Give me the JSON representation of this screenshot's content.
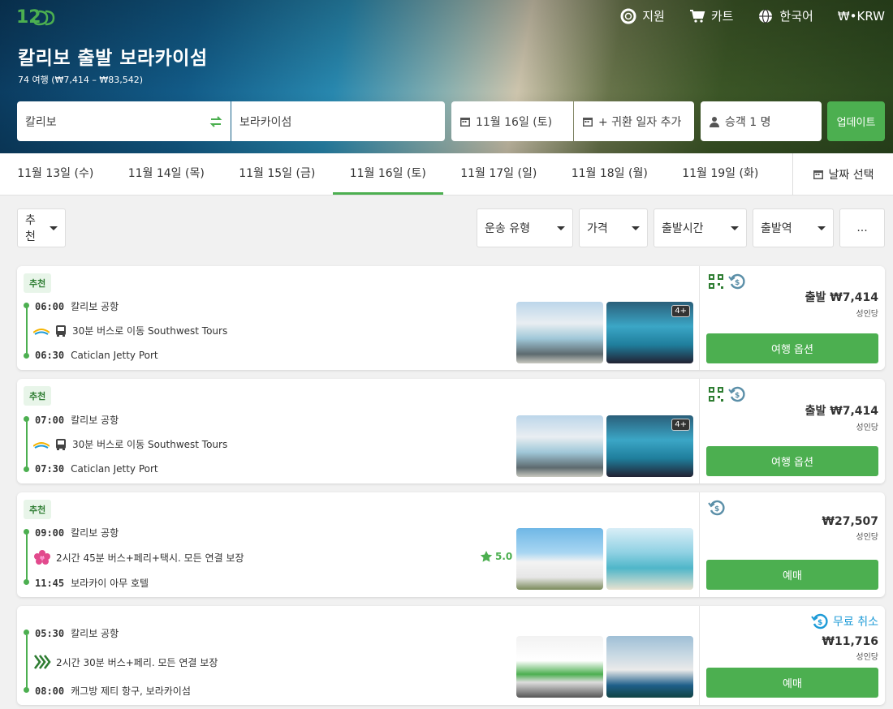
{
  "brand": {
    "logo_text": "12Go"
  },
  "topnav": {
    "support": "지원",
    "cart": "카트",
    "language": "한국어",
    "currency": "₩•KRW"
  },
  "header": {
    "title": "칼리보 출발 보라카이섬",
    "subtitle": "74 여행 (₩7,414 – ₩83,542)"
  },
  "search": {
    "from": "칼리보",
    "to": "보라카이섬",
    "date": "11월 16일 (토)",
    "return": "+ 귀환 일자 추가",
    "passengers": "승객 1 명",
    "update": "업데이트"
  },
  "dates": {
    "tabs": [
      "11월 13일 (수)",
      "11월 14일 (목)",
      "11월 15일 (금)",
      "11월 16일 (토)",
      "11월 17일 (일)",
      "11월 18일 (월)",
      "11월 19일 (화)"
    ],
    "active_index": 3,
    "pick": "날짜 선택"
  },
  "filters": {
    "sort": "추천",
    "transport": "운송 유형",
    "price": "가격",
    "departure_time": "출발시간",
    "departure_station": "출발역",
    "more": "..."
  },
  "results": [
    {
      "badge": "추천",
      "dep_time": "06:00",
      "dep_place": "칼리보 공항",
      "ride": "30분 버스로 이동 Southwest Tours",
      "arr_time": "06:30",
      "arr_place": "Caticlan Jetty Port",
      "photo_more": "4+",
      "price": "출발 ₩7,414",
      "unit": "성인당",
      "cta": "여행 옵션"
    },
    {
      "badge": "추천",
      "dep_time": "07:00",
      "dep_place": "칼리보 공항",
      "ride": "30분 버스로 이동 Southwest Tours",
      "arr_time": "07:30",
      "arr_place": "Caticlan Jetty Port",
      "photo_more": "4+",
      "price": "출발 ₩7,414",
      "unit": "성인당",
      "cta": "여행 옵션"
    },
    {
      "badge": "추천",
      "dep_time": "09:00",
      "dep_place": "칼리보 공항",
      "ride": "2시간 45분 버스+페리+택시. 모든 연결 보장",
      "rating": "5.0",
      "arr_time": "11:45",
      "arr_place": "보라카이 아무 호텔",
      "price": "₩27,507",
      "unit": "성인당",
      "cta": "예매"
    },
    {
      "dep_time": "05:30",
      "dep_place": "칼리보 공항",
      "ride": "2시간 30분 버스+페리. 모든 연결 보장",
      "arr_time": "08:00",
      "arr_place": "캐그방 제티 항구, 보라카이섬",
      "free_cancel": "무료 취소",
      "price": "₩11,716",
      "unit": "성인당",
      "cta": "예매"
    }
  ],
  "colors": {
    "accent": "#4caf50",
    "free_cancel": "#1e9bd7"
  }
}
